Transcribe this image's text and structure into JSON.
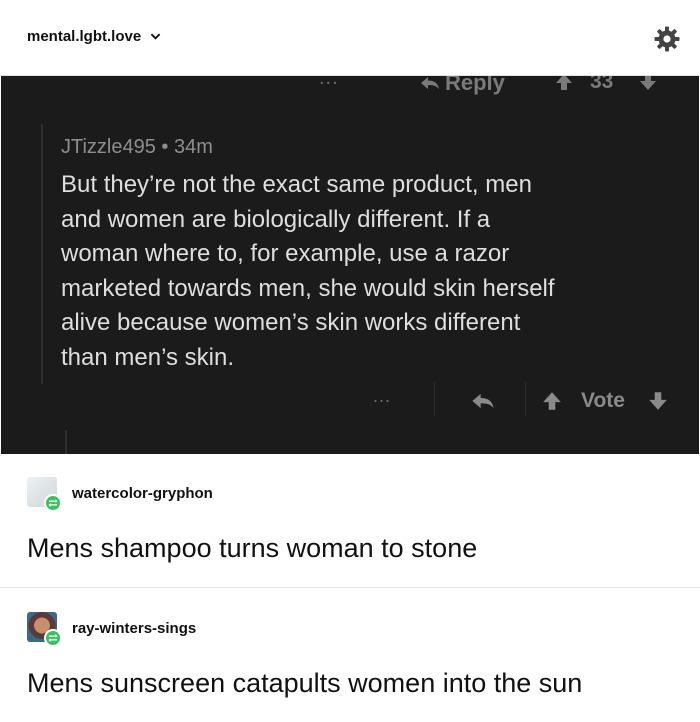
{
  "header": {
    "blog_name": "mental.lgbt.love",
    "icons": {
      "dropdown": "chevron-down-icon",
      "settings": "gear-icon"
    }
  },
  "screenshot": {
    "top_actions": {
      "more_label": "...",
      "reply_label": "Reply",
      "vote_count": "33"
    },
    "comment": {
      "author_line": "JTizzle495 • 34m",
      "lines": [
        "But they’re not the exact same product, men",
        "and women are biologically different. If a",
        "woman where to, for example, use a razor",
        "marketed towards men, she would skin herself",
        "alive because women’s skin works different",
        "than men’s skin."
      ]
    },
    "bottom_actions": {
      "more_label": "...",
      "vote_label": "Vote"
    },
    "colors": {
      "background": "#1b1b1b",
      "text": "#dedede",
      "meta": "#8e8e8e"
    }
  },
  "posts": [
    {
      "username": "watercolor-gryphon",
      "text": "Mens shampoo turns woman to stone"
    },
    {
      "username": "ray-winters-sings",
      "text": "Mens sunscreen catapults women into the sun"
    }
  ],
  "colors": {
    "reblog_badge": "#3ac060"
  }
}
